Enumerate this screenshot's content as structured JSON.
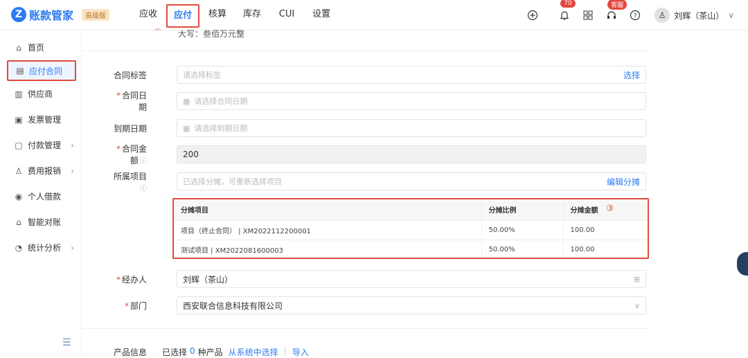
{
  "app": {
    "logo_mark": "Z",
    "title": "账款管家",
    "edition": "高级版"
  },
  "nav": {
    "items": [
      "应收",
      "应付",
      "核算",
      "库存",
      "CUI",
      "设置"
    ],
    "active": 1
  },
  "header": {
    "notification_count": "70",
    "service_badge": "客服",
    "user_name": "刘辉（茶山）",
    "user_chevron": "∨"
  },
  "sidebar": {
    "items": [
      {
        "icon": "⌂",
        "icon_name": "home-icon",
        "label": "首页",
        "chev": ""
      },
      {
        "icon": "▤",
        "icon_name": "contract-icon",
        "label": "应付合同",
        "chev": ""
      },
      {
        "icon": "▥",
        "icon_name": "supplier-icon",
        "label": "供应商",
        "chev": ""
      },
      {
        "icon": "▣",
        "icon_name": "invoice-icon",
        "label": "发票管理",
        "chev": ""
      },
      {
        "icon": "▢",
        "icon_name": "payment-icon",
        "label": "付款管理",
        "chev": "›"
      },
      {
        "icon": "♙",
        "icon_name": "expense-icon",
        "label": "费用报销",
        "chev": "›"
      },
      {
        "icon": "◉",
        "icon_name": "loan-icon",
        "label": "个人借款",
        "chev": ""
      },
      {
        "icon": "⌂",
        "icon_name": "reconcile-icon",
        "label": "智能对账",
        "chev": ""
      },
      {
        "icon": "◔",
        "icon_name": "stats-icon",
        "label": "统计分析",
        "chev": "›"
      }
    ]
  },
  "annotations": {
    "n1": "①",
    "n2": "②",
    "n3": "③"
  },
  "form": {
    "top_text": "大写：叁佰万元整",
    "contract_tag": {
      "label": "合同标签",
      "placeholder": "请选择标签",
      "action": "选择"
    },
    "contract_date": {
      "label": "合同日期",
      "placeholder": "请选择合同日期"
    },
    "due_date": {
      "label": "到期日期",
      "placeholder": "请选择到期日期"
    },
    "amount": {
      "label": "合同金额",
      "value": "200"
    },
    "project": {
      "label": "所属项目",
      "placeholder": "已选择分摊，可重新选择项目",
      "action": "编辑分摊"
    },
    "handler": {
      "label": "经办人",
      "value": "刘辉（茶山）"
    },
    "department": {
      "label": "部门",
      "value": "西安联合信息科技有限公司"
    }
  },
  "allocation": {
    "headers": [
      "分摊项目",
      "分摊比例",
      "分摊金额"
    ],
    "rows": [
      [
        "项目（终止合同） | XM2022112200001",
        "50.00%",
        "100.00"
      ],
      [
        "测试项目 | XM2022081600003",
        "50.00%",
        "100.00"
      ]
    ]
  },
  "products": {
    "label": "产品信息",
    "selected_prefix": "已选择",
    "count": "0",
    "selected_suffix": "种产品",
    "from_system": "从系统中选择",
    "import": "导入"
  }
}
